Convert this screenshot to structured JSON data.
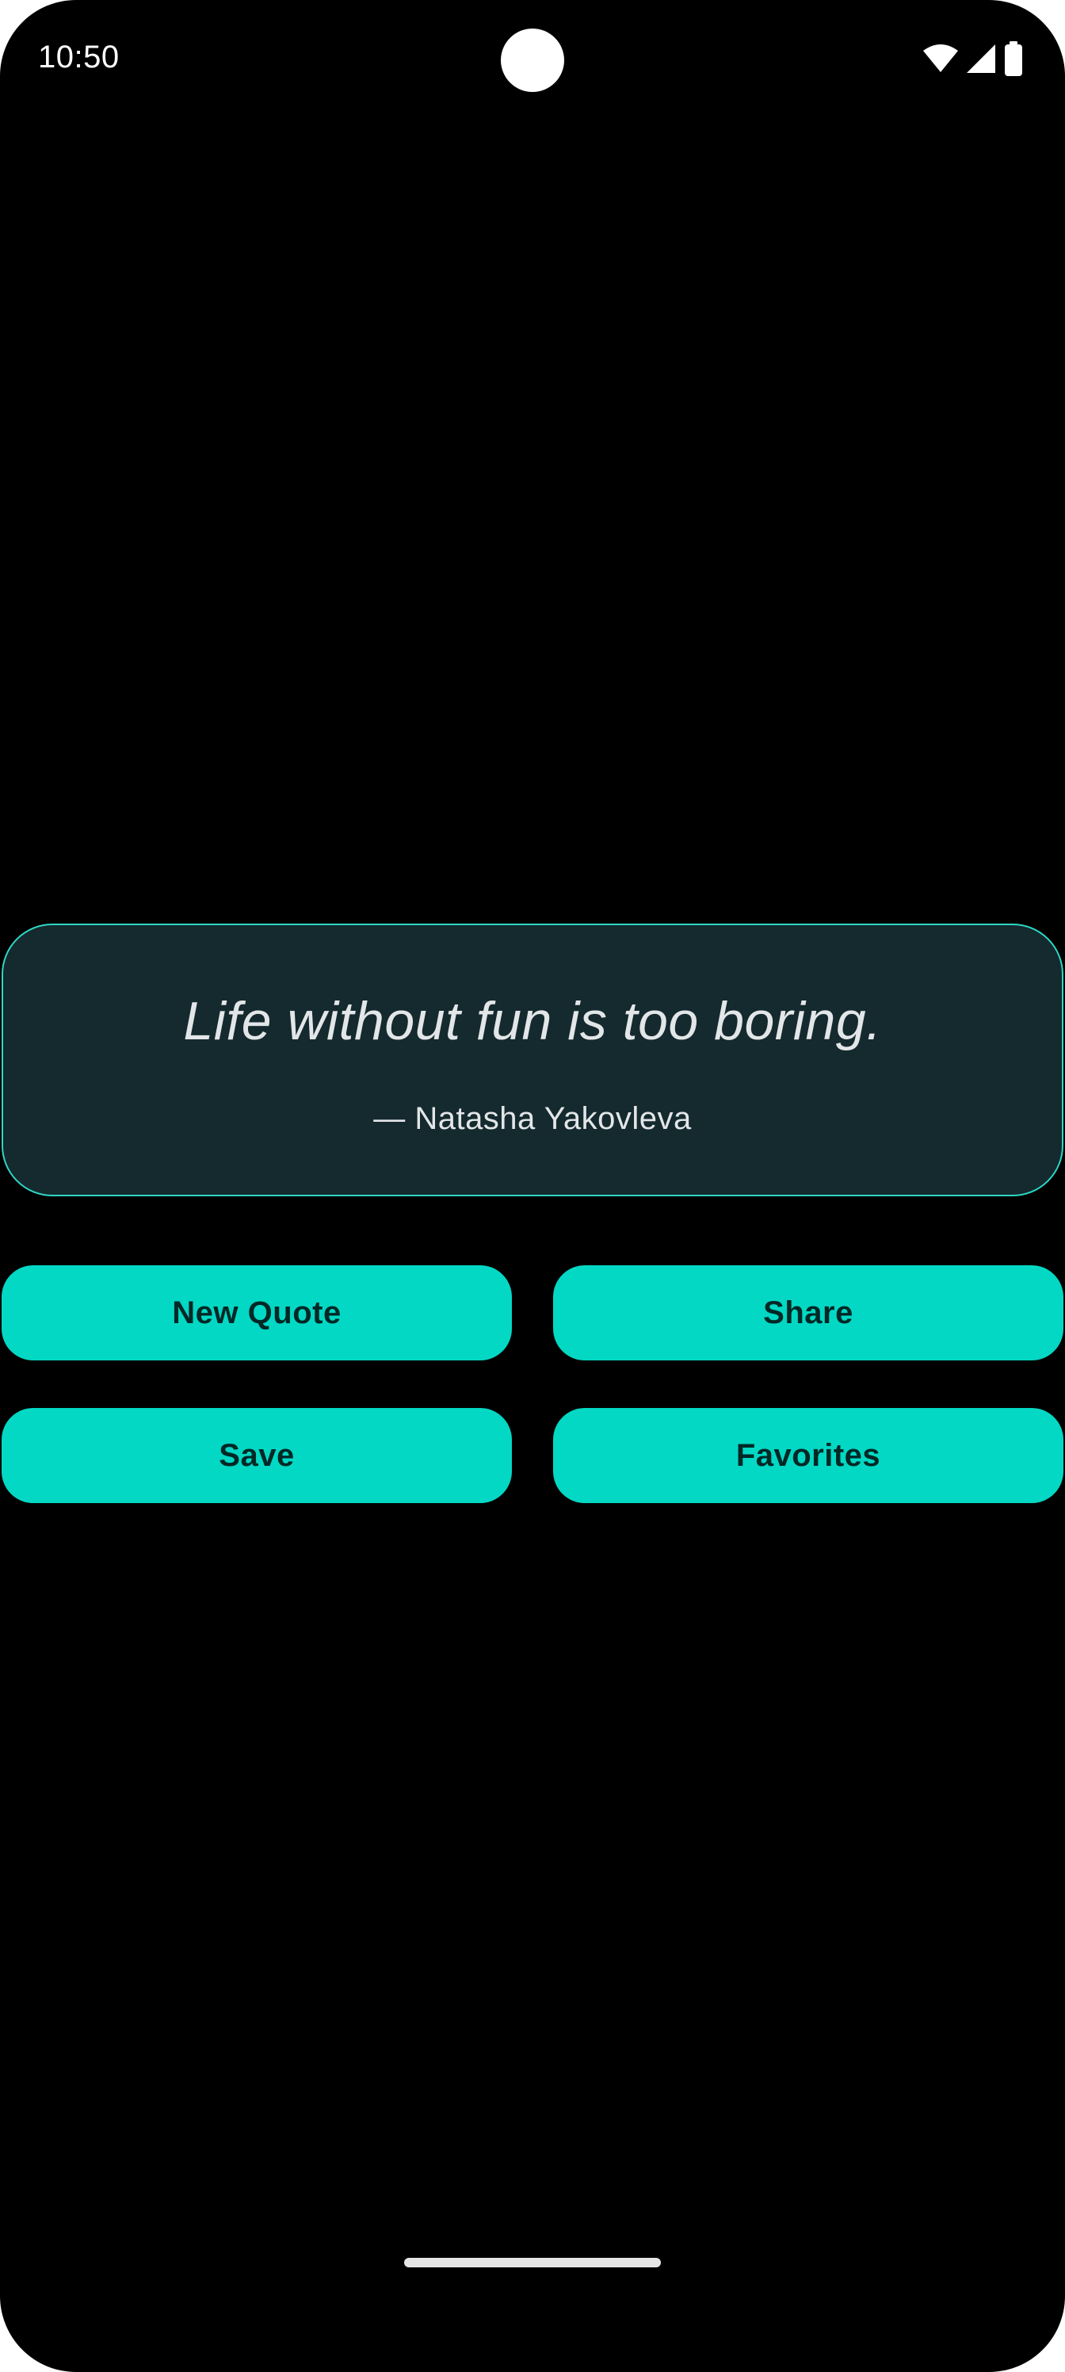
{
  "status_bar": {
    "time": "10:50",
    "icons": [
      "wifi-icon",
      "cellular-signal-icon",
      "battery-icon"
    ]
  },
  "quote": {
    "text": "Life without fun is too boring.",
    "author": "— Natasha Yakovleva"
  },
  "actions": {
    "new_quote_label": "New Quote",
    "share_label": "Share",
    "save_label": "Save",
    "favorites_label": "Favorites"
  },
  "colors": {
    "accent": "#03d8c4",
    "card_background": "#142a2e",
    "card_border": "#2fd6c4",
    "background": "#000000",
    "text_primary": "#e3e6e8",
    "button_text": "#002826"
  }
}
